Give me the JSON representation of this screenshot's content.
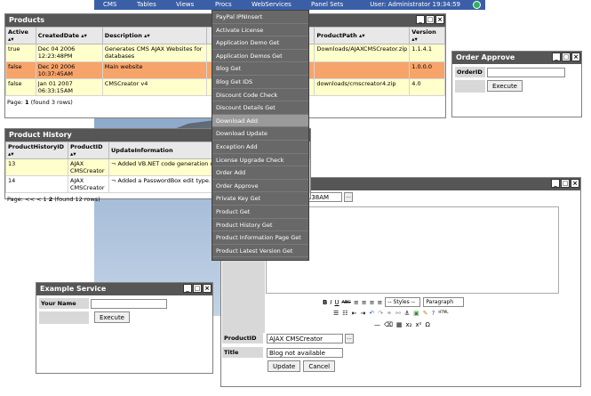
{
  "topbar": {
    "items": [
      "CMS",
      "Tables",
      "Views",
      "Procs",
      "WebServices",
      "Panel Sets"
    ],
    "user": "User: Administrator   19:34:59"
  },
  "products": {
    "title": "Products",
    "headers": [
      "Active",
      "CreatedDate",
      "Description",
      "ProductPath",
      "Version"
    ],
    "rows": [
      [
        "true",
        "Dec 04 2006 12:23:48PM",
        "Generates CMS AJAX Websites for databases",
        "Downloads/AJAXCMSCreator.zip",
        "1.1.4.1"
      ],
      [
        "false",
        "Dec 20 2006 10:37:45AM",
        "Main website",
        "",
        "1.0.0.0"
      ],
      [
        "false",
        "Jan 01 2007 06:33:15AM",
        "CMSCreator v4",
        "downloads/cmscreator4.zip",
        "4.0"
      ]
    ],
    "pager_prefix": "Page:",
    "pager_current": "1",
    "pager_suffix": "(found 3 rows)"
  },
  "history": {
    "title": "Product History",
    "headers": [
      "ProductHistoryID",
      "ProductID",
      "UpdateInformation"
    ],
    "rows": [
      [
        "13",
        "AJAX CMSCreator",
        "Added VB.NET code generation opt minor tweaks to the UI."
      ],
      [
        "14",
        "AJAX CMSCreator",
        "Added a PasswordBox edit type. F (in IE6)"
      ]
    ],
    "pager_prefix": "Page: << < 1",
    "pager_current": "2",
    "pager_suffix": "(found 12 rows)"
  },
  "order_approve": {
    "title": "Order Approve",
    "field_label": "OrderID",
    "field_value": "",
    "execute_label": "Execute"
  },
  "example_service": {
    "title": "Example Service",
    "field_label": "Your Name",
    "field_value": "",
    "execute_label": "Execute"
  },
  "menu": {
    "items": [
      "PayPal IPNInsert",
      "Activate License",
      "Application Demo Get",
      "Application Demos Get",
      "Blog Get",
      "Blog Get IDS",
      "Discount Code Check",
      "Discount Details Get",
      "Download Add",
      "Download Update",
      "Exception Add",
      "License Upgrade Check",
      "Order Add",
      "Order Approve",
      "Private Key Get",
      "Product Get",
      "Product History Get",
      "Product Information Page Get",
      "Product Latest Version Get"
    ],
    "active_index": 8
  },
  "editor": {
    "date_fragment": ":38AM",
    "styles_select": "-- Styles --",
    "format_select": "Paragraph",
    "productid_label": "ProductID",
    "productid_value": "AJAX CMSCreator",
    "title_label": "Title",
    "title_value": "Blog not available",
    "update_label": "Update",
    "cancel_label": "Cancel",
    "toolbar_bold": "B",
    "toolbar_italic": "I",
    "toolbar_underline": "U",
    "toolbar_strike": "ABC",
    "toolbar_html": "HTML",
    "toolbar_omega": "Ω",
    "toolbar_sub": "x₂",
    "toolbar_sup": "x²"
  },
  "window_buttons": {
    "min": "_",
    "max": "□",
    "close": "×"
  }
}
